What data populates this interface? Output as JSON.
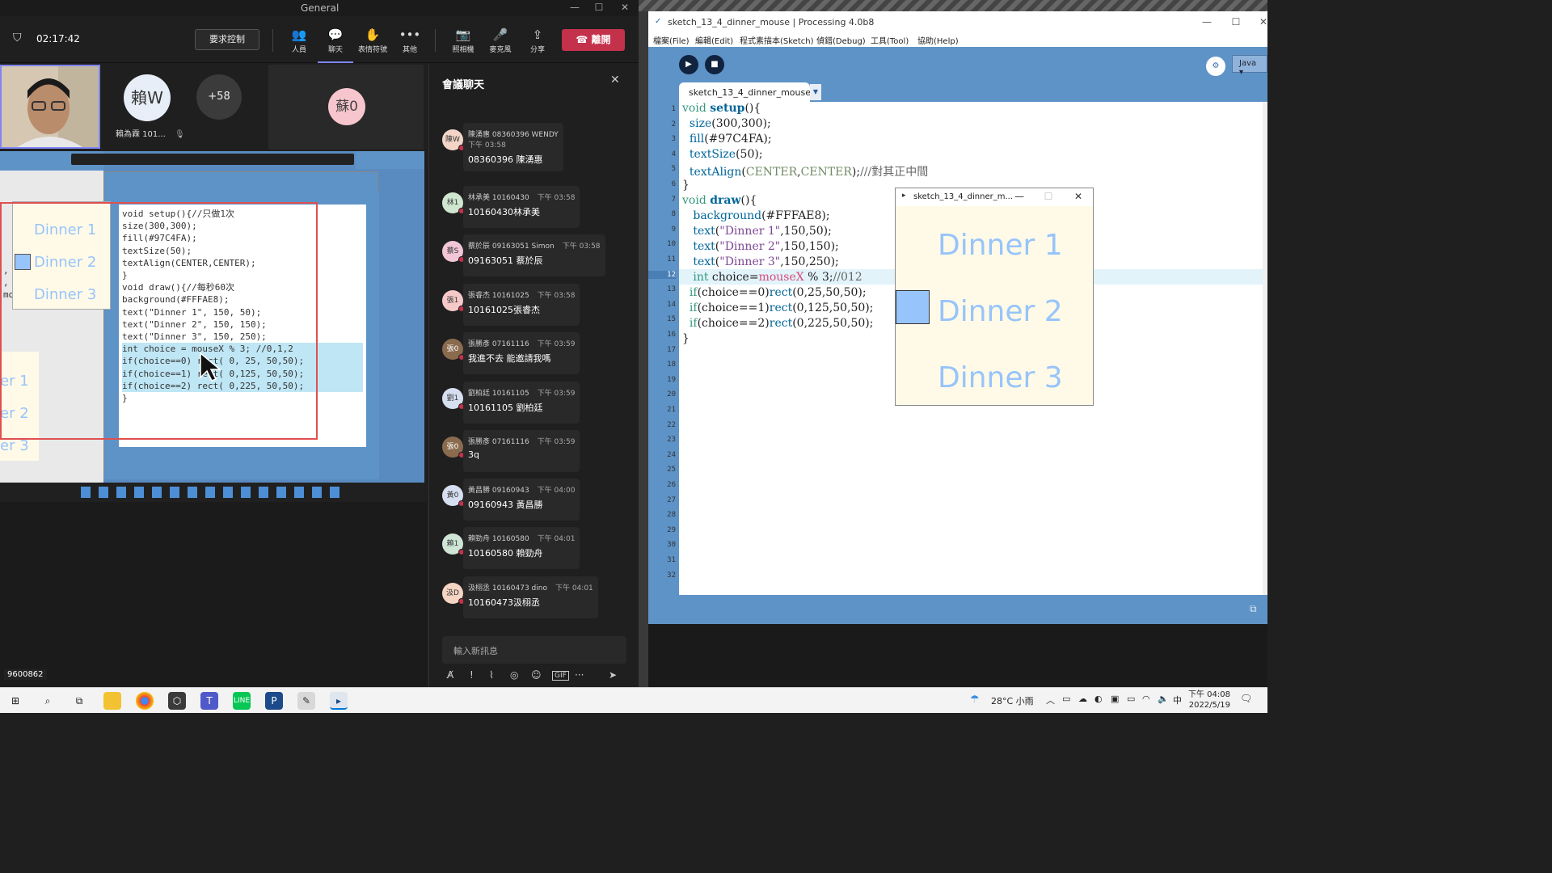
{
  "teams": {
    "window_title": "General",
    "timer": "02:17:42",
    "request_control": "要求控制",
    "toolbar": {
      "people": "人員",
      "chat": "聊天",
      "reactions": "表情符號",
      "more": "其他",
      "camera": "照相機",
      "mic": "麥克風",
      "share": "分享",
      "leave": "離開"
    },
    "participants": {
      "lai_initials": "賴W",
      "lai_name": "賴為霖 101...",
      "more_count": "+58",
      "su_initials": "蘇0"
    },
    "stage_label": "9600862",
    "chat": {
      "title": "會議聊天",
      "input_placeholder": "輸入新訊息",
      "messages": [
        {
          "initials": "陳W",
          "name": "陳湧惠 08360396 WENDY",
          "time": "下午 03:58",
          "text": "08360396 陳湧惠",
          "color": "#f3d5c8"
        },
        {
          "initials": "林1",
          "name": "林承美 10160430",
          "time": "下午 03:58",
          "text": "10160430林承美",
          "color": "#cfe6cf"
        },
        {
          "initials": "蔡S",
          "name": "蔡於辰 09163051 Simon",
          "time": "下午 03:58",
          "text": "09163051 蔡於辰",
          "color": "#f1c6d6"
        },
        {
          "initials": "張1",
          "name": "張睿杰 10161025",
          "time": "下午 03:58",
          "text": "10161025張睿杰",
          "color": "#f6c9c9"
        },
        {
          "initials": "張0",
          "name": "張勝彥 07161116",
          "time": "下午 03:59",
          "text": "我進不去 能邀請我嗎",
          "color": "#8a6b4e"
        },
        {
          "initials": "劉1",
          "name": "劉柏廷 10161105",
          "time": "下午 03:59",
          "text": "10161105 劉柏廷",
          "color": "#d5dff0"
        },
        {
          "initials": "張0",
          "name": "張勝彥 07161116",
          "time": "下午 03:59",
          "text": "3q",
          "color": "#8a6b4e"
        },
        {
          "initials": "黃0",
          "name": "黃昌勝 09160943",
          "time": "下午 04:00",
          "text": "09160943 黃昌勝",
          "color": "#d5dff0"
        },
        {
          "initials": "賴1",
          "name": "賴勁舟 10160580",
          "time": "下午 04:01",
          "text": "10160580 賴勁舟",
          "color": "#cfe6d6"
        },
        {
          "initials": "汲D",
          "name": "汲栩丞 10160473 dino",
          "time": "下午 04:01",
          "text": "10160473汲栩丞",
          "color": "#f4d4c2"
        }
      ]
    }
  },
  "processing": {
    "window_title": "sketch_13_4_dinner_mouse | Processing 4.0b8",
    "menus": [
      "檔案(File)",
      "編輯(Edit)",
      "程式素描本(Sketch)",
      "偵錯(Debug)",
      "工具(Tool)",
      "協助(Help)"
    ],
    "tab_name": "sketch_13_4_dinner_mouse",
    "mode": "Java",
    "code_lines": [
      "void setup(){",
      "  size(300,300);",
      "  fill(#97C4FA);",
      "  textSize(50);",
      "  textAlign(CENTER,CENTER);///對其正中間",
      "}",
      "void draw(){",
      "  background(#FFFAE8);",
      "  text(\"Dinner 1\",150,50);",
      "  text(\"Dinner 2\",150,150);",
      "  text(\"Dinner 3\",150,250);",
      "  int choice=mouseX % 3;//012",
      " if(choice==0)rect(0,25,50,50);",
      " if(choice==1)rect(0,125,50,50);",
      " if(choice==2)rect(0,225,50,50);",
      "}"
    ],
    "line_numbers": [
      "1",
      "2",
      "3",
      "4",
      "5",
      "6",
      "7",
      "8",
      "9",
      "10",
      "11",
      "12",
      "13",
      "14",
      "15",
      "16",
      "17",
      "18",
      "19",
      "20",
      "21",
      "22",
      "23",
      "24",
      "25",
      "26",
      "27",
      "28",
      "29",
      "30",
      "31",
      "32"
    ],
    "highlight_line": "12"
  },
  "sketch_window": {
    "title": "sketch_13_4_dinner_m...",
    "items": [
      "Dinner 1",
      "Dinner 2",
      "Dinner 3"
    ],
    "selected_index": 1,
    "fill_color": "#97C4FA",
    "background_color": "#FFFAE8"
  },
  "shared_screen": {
    "items": [
      "Dinner 1",
      "Dinner 2",
      "Dinner 3"
    ],
    "partial_items": [
      "er 1",
      "er 2",
      "er 3"
    ],
    "code_lines": [
      "void setup(){//只做1次",
      "  size(300,300);",
      "  fill(#97C4FA);",
      "  textSize(50);",
      "  textAlign(CENTER,CENTER);",
      "}",
      "void draw(){//每秒60次",
      "  background(#FFFAE8);",
      "  text(\"Dinner 1\", 150,  50);",
      "  text(\"Dinner 2\", 150, 150);",
      "  text(\"Dinner 3\", 150, 250);",
      "  int choice = mouseX % 3; //0,1,2",
      "  if(choice==0) rect( 0, 25, 50,50);",
      "  if(choice==1) rect( 0,125, 50,50);",
      "  if(choice==2) rect( 0,225, 50,50);",
      "}"
    ]
  },
  "taskbar": {
    "weather": "28°C  小雨",
    "time": "下午 04:08",
    "date": "2022/5/19",
    "ime": "中"
  }
}
